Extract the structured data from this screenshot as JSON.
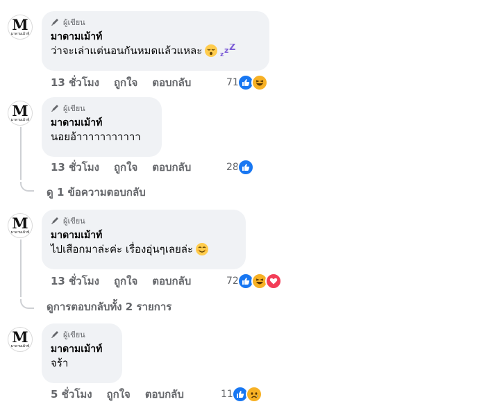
{
  "author_badge": "ผู้เขียน",
  "author_name": "มาดามเม้าท์",
  "avatar": {
    "letter": "M",
    "sub": "มาดามเม้าท์"
  },
  "actions": {
    "like": "ถูกใจ",
    "reply": "ตอบกลับ"
  },
  "comments": [
    {
      "text": "ว่าจะเล่าแต่นอนกันหมดแล้วแหละ",
      "emojis": [
        "sleepy-face-emoji",
        "zzz-emoji"
      ],
      "time": "13 ชั่วโมง",
      "reaction_count": "71",
      "reactions": [
        "like",
        "haha"
      ]
    },
    {
      "text": "นอยอ้าาาาาาาาาาา",
      "emojis": [],
      "time": "13 ชั่วโมง",
      "reaction_count": "28",
      "reactions": [
        "like"
      ],
      "replies_link": "ดู 1 ข้อความตอบกลับ"
    },
    {
      "text": "ไปเสือกมาล่ะค่ะ เรื่องอุ่นๆเลยล่ะ",
      "emojis": [
        "smiling-face-emoji"
      ],
      "time": "13 ชั่วโมง",
      "reaction_count": "72",
      "reactions": [
        "like",
        "haha",
        "love"
      ],
      "replies_link": "ดูการตอบกลับทั้ง 2 รายการ"
    },
    {
      "text": "จร้า",
      "emojis": [],
      "time": "5 ชั่วโมง",
      "reaction_count": "11",
      "reactions": [
        "like",
        "sad"
      ]
    }
  ],
  "colors": {
    "like": "#1877f2",
    "love": "#f33e58",
    "haha": "#f7b125",
    "bubble": "#f0f2f5",
    "meta": "#65676b"
  }
}
